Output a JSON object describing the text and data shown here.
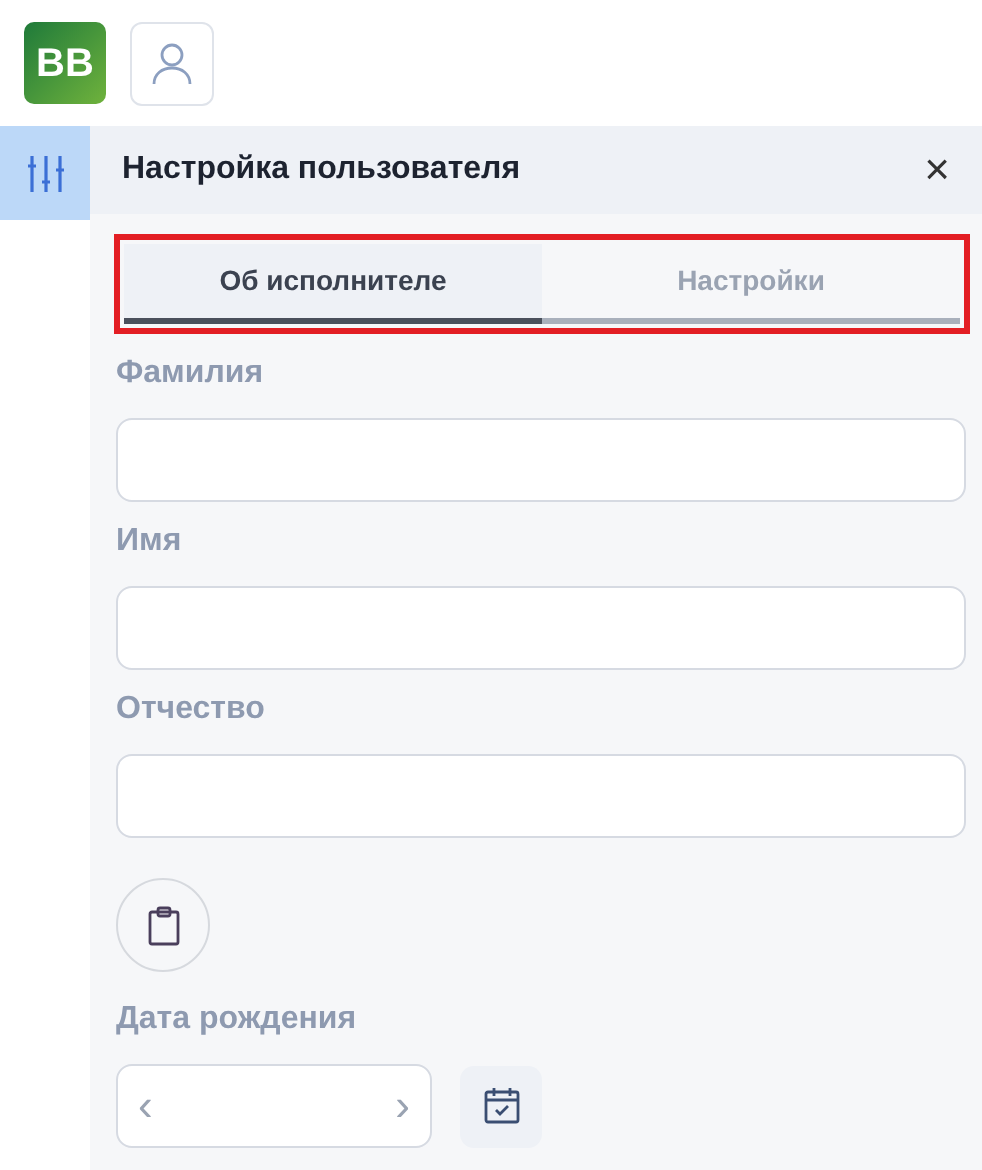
{
  "app": {
    "logo": "BB"
  },
  "panel": {
    "title": "Настройка пользователя",
    "close": "×"
  },
  "tabs": [
    {
      "label": "Об исполнителе",
      "selected": true
    },
    {
      "label": "Настройки",
      "selected": false
    }
  ],
  "fields": [
    {
      "label": "Фамилия"
    },
    {
      "label": "Имя"
    },
    {
      "label": "Отчество"
    }
  ],
  "birth_date": {
    "label": "Дата рождения",
    "prev": "‹",
    "next": "›"
  }
}
